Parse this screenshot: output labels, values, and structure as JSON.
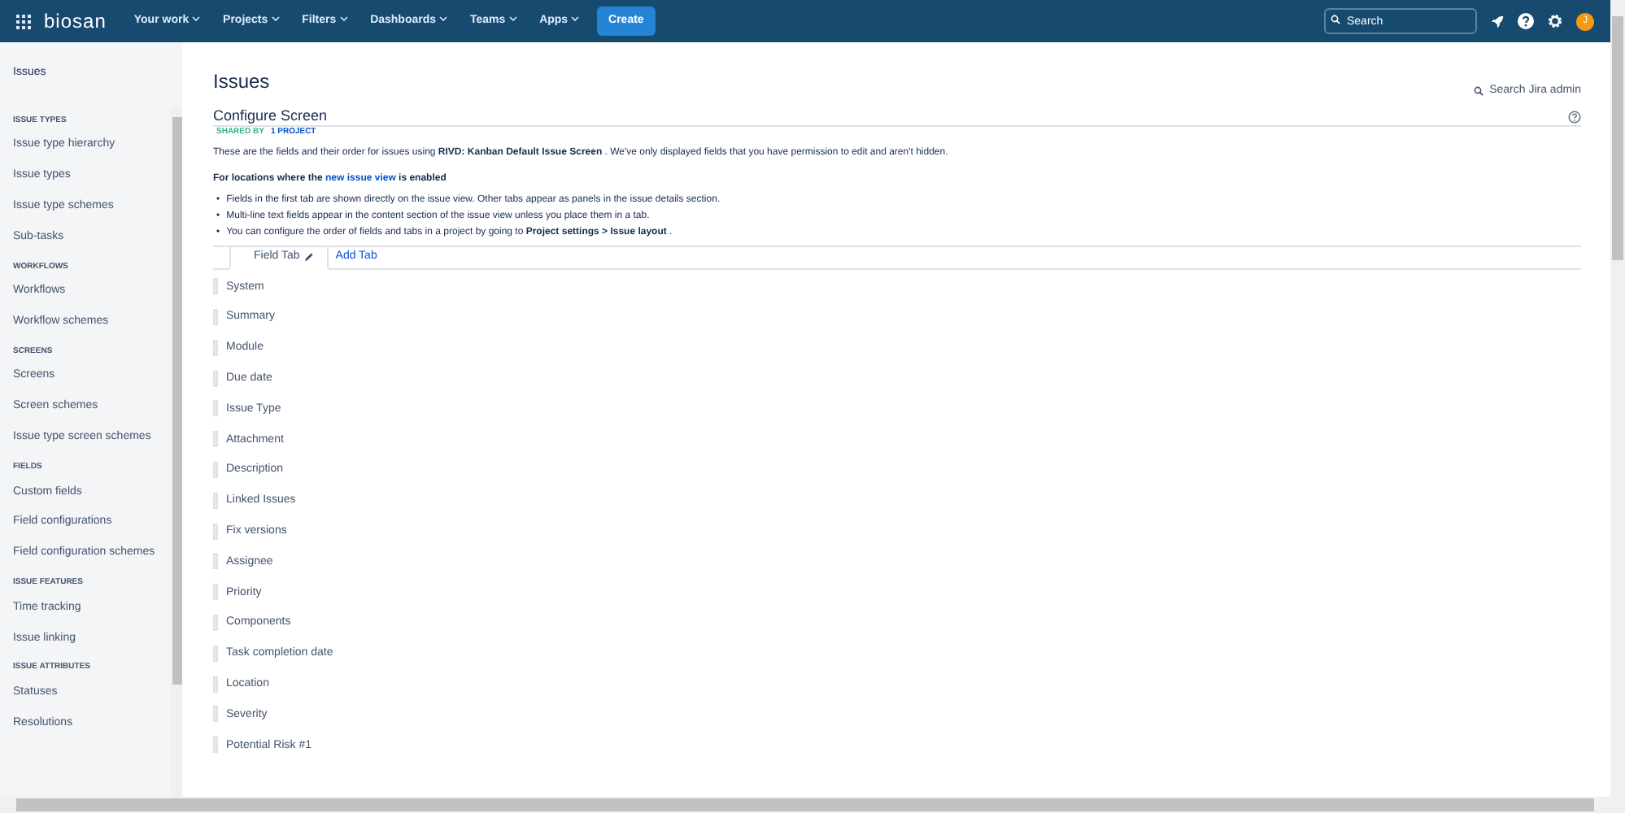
{
  "navbar": {
    "logo": "biosan",
    "menus": [
      {
        "label": "Your work"
      },
      {
        "label": "Projects"
      },
      {
        "label": "Filters"
      },
      {
        "label": "Dashboards"
      },
      {
        "label": "Teams"
      },
      {
        "label": "Apps"
      }
    ],
    "create": "Create",
    "search": {
      "placeholder": "Search"
    },
    "avatar": "J"
  },
  "sidebar": {
    "title": "Issues",
    "sections": [
      {
        "heading": "ISSUE TYPES",
        "items": [
          {
            "label": "Issue type hierarchy",
            "selected": false
          },
          {
            "label": "Issue types",
            "selected": false
          },
          {
            "label": "Issue type schemes",
            "selected": false
          },
          {
            "label": "Sub-tasks",
            "selected": false
          }
        ]
      },
      {
        "heading": "WORKFLOWS",
        "items": [
          {
            "label": "Workflows",
            "selected": false
          },
          {
            "label": "Workflow schemes",
            "selected": false
          }
        ]
      },
      {
        "heading": "SCREENS",
        "items": [
          {
            "label": "Screens",
            "selected": false
          },
          {
            "label": "Screen schemes",
            "selected": false
          },
          {
            "label": "Issue type screen schemes",
            "selected": false
          }
        ]
      },
      {
        "heading": "FIELDS",
        "items": [
          {
            "label": "Custom fields",
            "selected": false
          },
          {
            "label": "Field configurations",
            "selected": false
          },
          {
            "label": "Field configuration schemes",
            "selected": false
          }
        ]
      },
      {
        "heading": "ISSUE FEATURES",
        "items": [
          {
            "label": "Time tracking",
            "selected": false
          },
          {
            "label": "Issue linking",
            "selected": false
          }
        ]
      },
      {
        "heading": "ISSUE ATTRIBUTES",
        "items": [
          {
            "label": "Statuses",
            "selected": false
          },
          {
            "label": "Resolutions",
            "selected": false
          }
        ]
      }
    ]
  },
  "main": {
    "title": "Issues",
    "admin_search": "Search Jira admin",
    "section_title": "Configure Screen",
    "shared_label": "SHARED BY",
    "shared_link": "1 PROJECT",
    "intro": "These are the fields and their order for issues using **RIVD: Kanban Default Issue Screen** . We've only displayed fields that you have permission to edit and aren't hidden.",
    "notice": {
      "before": "For locations where the",
      "link": "new issue view",
      "after": "is enabled"
    },
    "bullets": [
      {
        "marker": "•",
        "text": "Fields in the first tab are shown directly on the issue view. Other tabs appear as panels in the issue details section."
      },
      {
        "marker": "•",
        "text": "Multi-line text fields appear in the content section of the issue view unless you place them in a tab."
      },
      {
        "marker": "•",
        "text": "You can configure the order of fields and tabs in a project by going to **Project settings > Issue layout** ."
      }
    ],
    "tabs": [
      {
        "label": "Field Tab",
        "selected": true
      }
    ],
    "add_tab": "Add Tab",
    "fields": [
      "System",
      "Summary",
      "Module",
      "Due date",
      "Issue Type",
      "Attachment",
      "Description",
      "Linked Issues",
      "Fix versions",
      "Assignee",
      "Priority",
      "Components",
      "Task completion date",
      "Location",
      "Severity",
      "Potential Risk #1"
    ]
  }
}
